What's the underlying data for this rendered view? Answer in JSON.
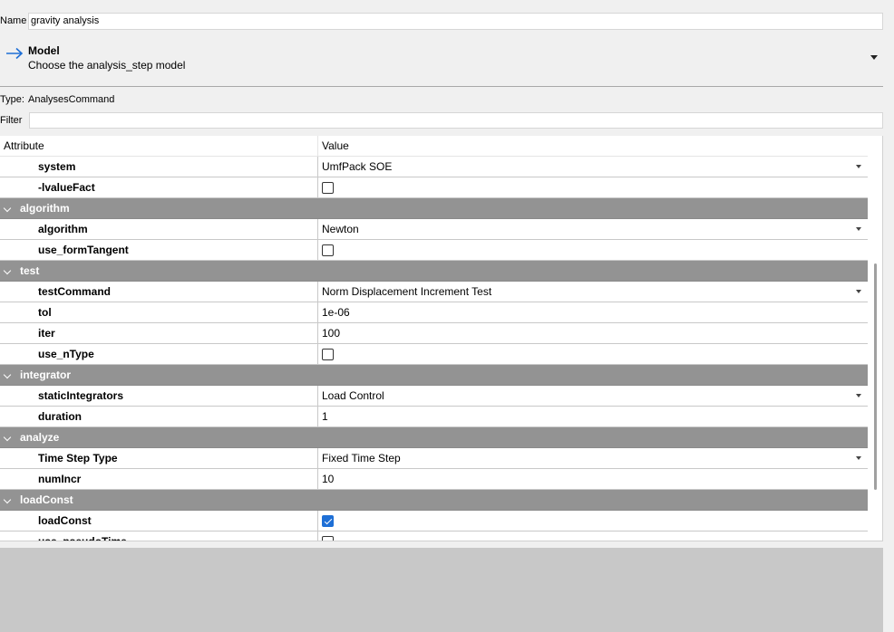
{
  "name_field": {
    "label": "Name",
    "value": "gravity analysis"
  },
  "model": {
    "title": "Model",
    "subtitle": "Choose the analysis_step model",
    "icon": "arrow-right-icon"
  },
  "type": {
    "label": "Type:",
    "value": "AnalysesCommand"
  },
  "filter": {
    "label": "Filter",
    "value": ""
  },
  "table": {
    "columns": [
      "Attribute",
      "Value"
    ],
    "rows": [
      {
        "kind": "attr",
        "name": "system",
        "value": "UmfPack SOE",
        "control": "dropdown"
      },
      {
        "kind": "attr",
        "name": "-lvalueFact",
        "control": "checkbox",
        "checked": false
      },
      {
        "kind": "group",
        "name": "algorithm"
      },
      {
        "kind": "attr",
        "name": "algorithm",
        "value": "Newton",
        "control": "dropdown"
      },
      {
        "kind": "attr",
        "name": "use_formTangent",
        "control": "checkbox",
        "checked": false
      },
      {
        "kind": "group",
        "name": "test"
      },
      {
        "kind": "attr",
        "name": "testCommand",
        "value": "Norm Displacement Increment Test",
        "control": "dropdown"
      },
      {
        "kind": "attr",
        "name": "tol",
        "value": "1e-06",
        "control": "text"
      },
      {
        "kind": "attr",
        "name": "iter",
        "value": "100",
        "control": "text"
      },
      {
        "kind": "attr",
        "name": "use_nType",
        "control": "checkbox",
        "checked": false
      },
      {
        "kind": "group",
        "name": "integrator"
      },
      {
        "kind": "attr",
        "name": "staticIntegrators",
        "value": "Load Control",
        "control": "dropdown"
      },
      {
        "kind": "attr",
        "name": "duration",
        "value": "1",
        "control": "text"
      },
      {
        "kind": "group",
        "name": "analyze"
      },
      {
        "kind": "attr",
        "name": "Time Step Type",
        "value": "Fixed Time Step",
        "control": "dropdown"
      },
      {
        "kind": "attr",
        "name": "numIncr",
        "value": "10",
        "control": "text"
      },
      {
        "kind": "group",
        "name": "loadConst"
      },
      {
        "kind": "attr",
        "name": "loadConst",
        "control": "checkbox",
        "checked": true
      },
      {
        "kind": "attr",
        "name": "use_pseudoTime",
        "control": "checkbox",
        "checked": false
      }
    ]
  },
  "colors": {
    "group_row_bg": "#939393",
    "checkbox_checked": "#1e6fd6",
    "model_arrow": "#1e6fd6",
    "bottom_pane": "#c8c8c8"
  }
}
